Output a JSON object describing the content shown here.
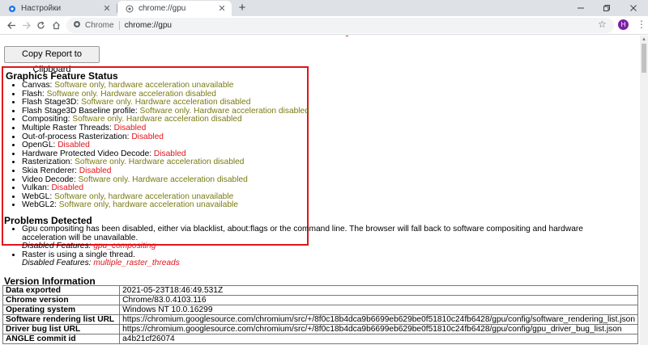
{
  "browser": {
    "tabs": [
      {
        "title": "Настройки",
        "icon": "gear-icon",
        "active": false
      },
      {
        "title": "chrome://gpu",
        "icon": "globe-icon",
        "active": true
      }
    ],
    "omnibox": {
      "chip": "Chrome",
      "url": "chrome://gpu"
    },
    "avatar_letter": "H",
    "avatar_color": "#7b1fa2"
  },
  "page": {
    "copy_button": "Copy Report to Clipboard",
    "feature_status": {
      "title": "Graphics Feature Status",
      "items": [
        {
          "name": "Canvas: ",
          "value": "Software only, hardware acceleration unavailable",
          "tone": "olive"
        },
        {
          "name": "Flash: ",
          "value": "Software only. Hardware acceleration disabled",
          "tone": "olive"
        },
        {
          "name": "Flash Stage3D: ",
          "value": "Software only. Hardware acceleration disabled",
          "tone": "olive"
        },
        {
          "name": "Flash Stage3D Baseline profile: ",
          "value": "Software only. Hardware acceleration disabled",
          "tone": "olive"
        },
        {
          "name": "Compositing: ",
          "value": "Software only. Hardware acceleration disabled",
          "tone": "olive"
        },
        {
          "name": "Multiple Raster Threads: ",
          "value": "Disabled",
          "tone": "red"
        },
        {
          "name": "Out-of-process Rasterization: ",
          "value": "Disabled",
          "tone": "red"
        },
        {
          "name": "OpenGL: ",
          "value": "Disabled",
          "tone": "red"
        },
        {
          "name": "Hardware Protected Video Decode: ",
          "value": "Disabled",
          "tone": "red"
        },
        {
          "name": "Rasterization: ",
          "value": "Software only. Hardware acceleration disabled",
          "tone": "olive"
        },
        {
          "name": "Skia Renderer: ",
          "value": "Disabled",
          "tone": "red"
        },
        {
          "name": "Video Decode: ",
          "value": "Software only. Hardware acceleration disabled",
          "tone": "olive"
        },
        {
          "name": "Vulkan: ",
          "value": "Disabled",
          "tone": "red"
        },
        {
          "name": "WebGL: ",
          "value": "Software only, hardware acceleration unavailable",
          "tone": "olive"
        },
        {
          "name": "WebGL2: ",
          "value": "Software only, hardware acceleration unavailable",
          "tone": "olive"
        }
      ]
    },
    "problems": {
      "title": "Problems Detected",
      "items": [
        {
          "text": "Gpu compositing has been disabled, either via blacklist, about:flags or the command line. The browser will fall back to software compositing and hardware acceleration will be unavailable.",
          "features_label": "Disabled Features: ",
          "features": "gpu_compositing"
        },
        {
          "text": "Raster is using a single thread.",
          "features_label": "Disabled Features: ",
          "features": "multiple_raster_threads"
        }
      ]
    },
    "version": {
      "title": "Version Information",
      "rows": [
        {
          "key": "Data exported",
          "value": "2021-05-23T18:46:49.531Z"
        },
        {
          "key": "Chrome version",
          "value": "Chrome/83.0.4103.116"
        },
        {
          "key": "Operating system",
          "value": "Windows NT 10.0.16299"
        },
        {
          "key": "Software rendering list URL",
          "value": "https://chromium.googlesource.com/chromium/src/+/8f0c18b4dca9b6699eb629be0f51810c24fb6428/gpu/config/software_rendering_list.json"
        },
        {
          "key": "Driver bug list URL",
          "value": "https://chromium.googlesource.com/chromium/src/+/8f0c18b4dca9b6699eb629be0f51810c24fb6428/gpu/config/gpu_driver_bug_list.json"
        },
        {
          "key": "ANGLE commit id",
          "value": "a4b21cf26074"
        }
      ]
    }
  },
  "colors": {
    "accent_red": "#e0151b",
    "olive": "#7a7a14"
  }
}
